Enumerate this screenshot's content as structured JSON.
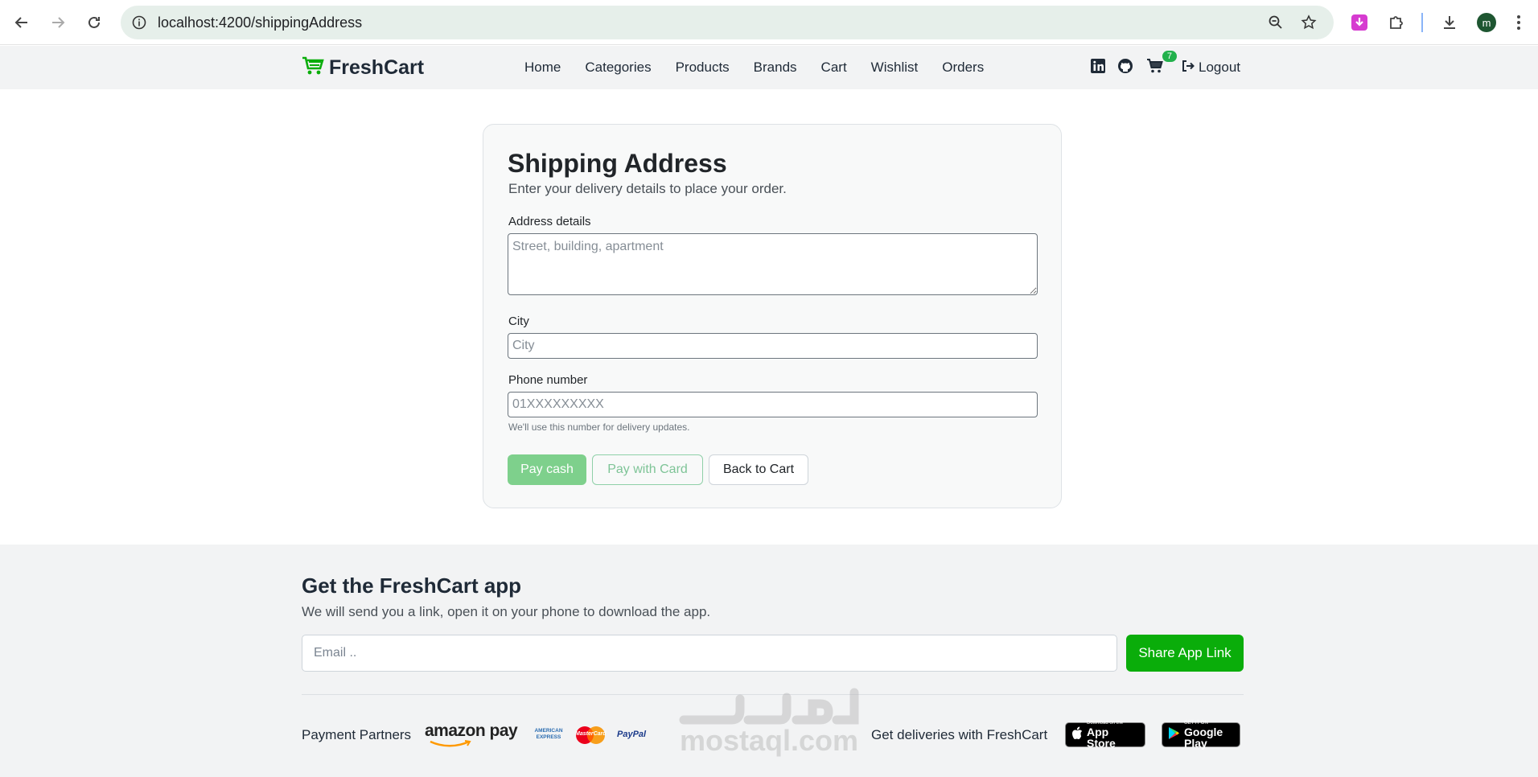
{
  "browser": {
    "url": "localhost:4200/shippingAddress",
    "profile_initial": "m"
  },
  "navbar": {
    "brand": "FreshCart",
    "links": [
      "Home",
      "Categories",
      "Products",
      "Brands",
      "Cart",
      "Wishlist",
      "Orders"
    ],
    "cart_count": "7",
    "logout_label": "Logout"
  },
  "form": {
    "title": "Shipping Address",
    "subtitle": "Enter your delivery details to place your order.",
    "address_label": "Address details",
    "address_placeholder": "Street, building, apartment",
    "city_label": "City",
    "city_placeholder": "City",
    "phone_label": "Phone number",
    "phone_placeholder": "01XXXXXXXXX",
    "phone_hint": "We'll use this number for delivery updates.",
    "pay_cash_label": "Pay cash",
    "pay_card_label": "Pay with Card",
    "back_label": "Back to Cart"
  },
  "footer": {
    "title": "Get the FreshCart app",
    "subtitle": "We will send you a link, open it on your phone to download the app.",
    "email_placeholder": "Email ..",
    "share_label": "Share App Link",
    "payment_label": "Payment Partners",
    "amazon_pay": "amazon pay",
    "amex_line1": "AMERICAN",
    "amex_line2": "EXPRESS",
    "mastercard": "MasterCard",
    "paypal": "PayPal",
    "deliveries_label": "Get deliveries with FreshCart",
    "app_store_small": "Download on the",
    "app_store_big": "App Store",
    "google_play_small": "GET IT ON",
    "google_play_big": "Google Play"
  },
  "watermark": "mostaql.com",
  "colors": {
    "brand_green": "#0aad0a",
    "badge_green": "#22b14c",
    "pay_cash_bg": "#7ed08c",
    "navbar_bg": "#f2f3f4"
  }
}
